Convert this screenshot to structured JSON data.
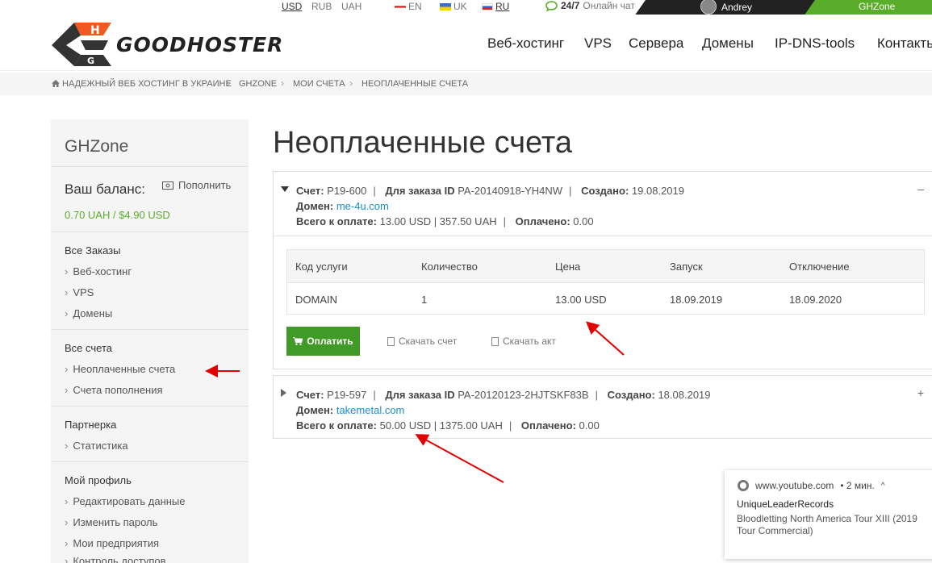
{
  "topbar": {
    "currencies": [
      "USD",
      "RUB",
      "UAH"
    ],
    "languages": [
      "EN",
      "UK",
      "RU"
    ],
    "chat_hours": "24/7",
    "chat_label": "Онлайн чат",
    "user_name": "Andrey",
    "zone_label": "GHZone"
  },
  "header": {
    "logo_text": "GOODHOSTER",
    "nav": [
      "Веб-хостинг",
      "VPS",
      "Сервера",
      "Домены",
      "IP-DNS-tools",
      "Контакты"
    ]
  },
  "breadcrumbs": [
    "Надежный веб хостинг в Украине",
    "GHZone",
    "Мои счета",
    "Неоплаченные счета"
  ],
  "sidebar": {
    "title": "GHZone",
    "balance_label": "Ваш баланс:",
    "topup_label": "Пополнить",
    "balance_amount": "0.70 UAH / $4.90 USD",
    "orders_head": "Все Заказы",
    "orders_items": [
      "Веб-хостинг",
      "VPS",
      "Домены"
    ],
    "invoices_head": "Все счета",
    "invoices_items": [
      "Неоплаченные счета",
      "Счета пополнения"
    ],
    "partner_head": "Партнерка",
    "partner_items": [
      "Статистика"
    ],
    "profile_head": "Мой профиль",
    "profile_items": [
      "Редактировать данные",
      "Изменить пароль",
      "Мои предприятия",
      "Контроль доступов"
    ]
  },
  "main": {
    "title": "Неоплаченные счета",
    "labels": {
      "invoice": "Счет:",
      "order": "Для заказа ID",
      "created": "Создано:",
      "domain": "Домен:",
      "total": "Всего к оплате:",
      "paid": "Оплачено:"
    },
    "invoices": [
      {
        "number": "P19-600",
        "order_id": "PA-20140918-YH4NW",
        "created": "19.08.2019",
        "domain": "me-4u.com",
        "total": "13.00 USD | 357.50 UAH",
        "paid": "0.00",
        "toggle": "–"
      },
      {
        "number": "P19-597",
        "order_id": "PA-20120123-2HJTSKF83B",
        "created": "18.08.2019",
        "domain": "takemetal.com",
        "total": "50.00 USD | 1375.00 UAH",
        "paid": "0.00",
        "toggle": "+"
      }
    ],
    "table": {
      "headers": [
        "Код услуги",
        "Количество",
        "Цена",
        "Запуск",
        "Отключение"
      ],
      "rows": [
        [
          "DOMAIN",
          "1",
          "13.00 USD",
          "18.09.2019",
          "18.09.2020"
        ]
      ]
    },
    "pay_button": "Оплатить",
    "download_invoice": "Скачать счет",
    "download_act": "Скачать акт"
  },
  "notification": {
    "source": "www.youtube.com",
    "time": "• 2 мин.",
    "title": "UniqueLeaderRecords",
    "body": "Bloodletting North America Tour XIII (2019 Tour Commercial)"
  },
  "colors": {
    "accent_green": "#5aad2a",
    "button_green": "#3f9a26",
    "link_blue": "#1a8ecb",
    "annotation_red": "#e00000",
    "logo_orange": "#f05a22"
  }
}
